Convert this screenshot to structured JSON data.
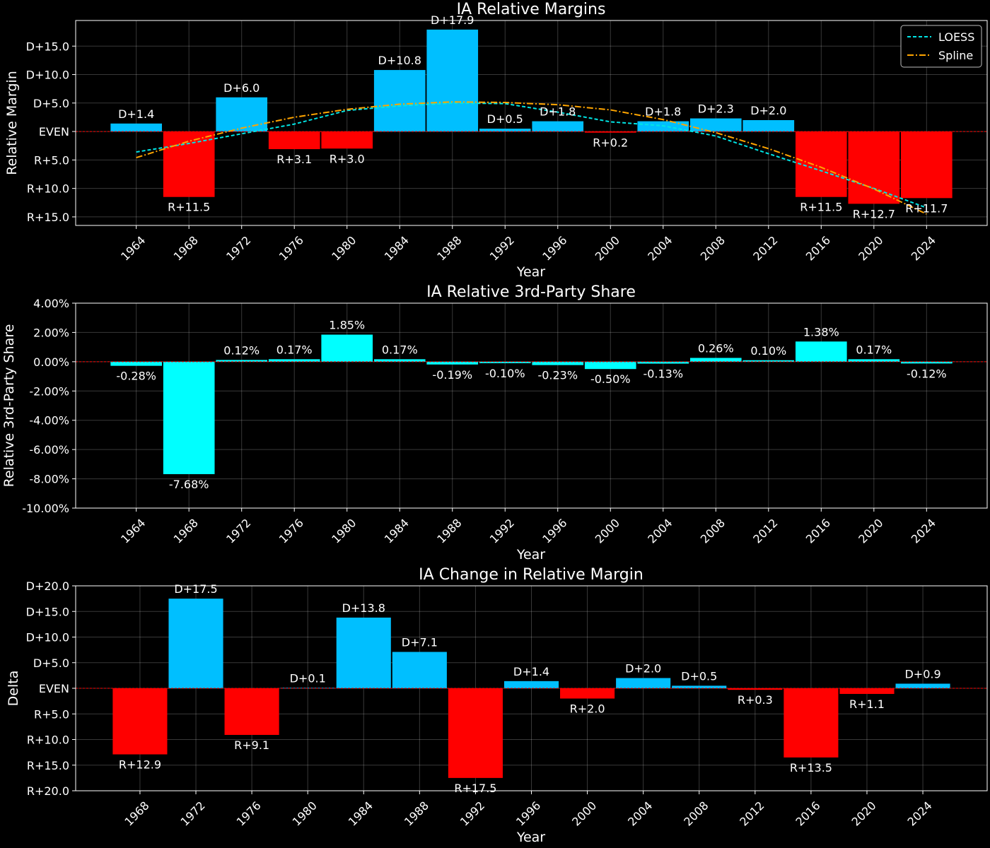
{
  "colors": {
    "background": "#000000",
    "dem": "#00bfff",
    "rep": "#ff0000",
    "third": "#00ffff",
    "zero_line": "#ff0000",
    "loess": "#00e5e5",
    "spline": "#ffa500"
  },
  "chart_data": [
    {
      "type": "bar",
      "title": "IA Relative Margins",
      "xlabel": "Year",
      "ylabel": "Relative Margin",
      "x": [
        1964,
        1968,
        1972,
        1976,
        1980,
        1984,
        1988,
        1992,
        1996,
        2000,
        2004,
        2008,
        2012,
        2016,
        2020,
        2024
      ],
      "x_tick_labels": [
        "1964",
        "1968",
        "1972",
        "1976",
        "1980",
        "1984",
        "1988",
        "1992",
        "1996",
        "2000",
        "2004",
        "2008",
        "2012",
        "2016",
        "2020",
        "2024"
      ],
      "values": [
        1.4,
        -11.5,
        6.0,
        -3.1,
        -3.0,
        10.8,
        17.9,
        0.5,
        1.8,
        -0.2,
        1.8,
        2.3,
        2.0,
        -11.5,
        -12.7,
        -11.7
      ],
      "labels": [
        "D+1.4",
        "R+11.5",
        "D+6.0",
        "R+3.1",
        "R+3.0",
        "D+10.8",
        "D+17.9",
        "D+0.5",
        "D+1.8",
        "R+0.2",
        "D+1.8",
        "D+2.3",
        "D+2.0",
        "R+11.5",
        "R+12.7",
        "R+11.7"
      ],
      "ylim": [
        -16.5,
        19.5
      ],
      "y_ticks": [
        15,
        10,
        5,
        0,
        -5,
        -10,
        -15
      ],
      "y_tick_labels": [
        "D+15.0",
        "D+10.0",
        "D+5.0",
        "EVEN",
        "R+5.0",
        "R+10.0",
        "R+15.0"
      ],
      "grid": true,
      "legend": {
        "placement": "top-right",
        "entries": [
          "LOESS",
          "Spline"
        ]
      },
      "lines": [
        {
          "name": "LOESS",
          "style": "dashed",
          "x": [
            1964,
            1968,
            1972,
            1976,
            1980,
            1984,
            1988,
            1992,
            1996,
            2000,
            2004,
            2008,
            2012,
            2016,
            2020,
            2024
          ],
          "values": [
            -3.6,
            -2.1,
            -0.4,
            1.3,
            3.7,
            4.5,
            5.0,
            4.9,
            3.4,
            1.7,
            1.0,
            -0.8,
            -3.9,
            -6.9,
            -10.0,
            -13.4
          ]
        },
        {
          "name": "Spline",
          "style": "dashdot",
          "x": [
            1964,
            1968,
            1972,
            1976,
            1980,
            1984,
            1988,
            1992,
            1996,
            2000,
            2004,
            2008,
            2012,
            2016,
            2020,
            2024
          ],
          "values": [
            -4.6,
            -1.7,
            0.6,
            2.5,
            3.9,
            4.8,
            5.2,
            5.1,
            4.7,
            3.8,
            2.1,
            -0.2,
            -3.0,
            -6.3,
            -10.1,
            -14.5
          ]
        }
      ]
    },
    {
      "type": "bar",
      "title": "IA Relative 3rd-Party Share",
      "xlabel": "Year",
      "ylabel": "Relative 3rd-Party Share",
      "x": [
        1964,
        1968,
        1972,
        1976,
        1980,
        1984,
        1988,
        1992,
        1996,
        2000,
        2004,
        2008,
        2012,
        2016,
        2020,
        2024
      ],
      "x_tick_labels": [
        "1964",
        "1968",
        "1972",
        "1976",
        "1980",
        "1984",
        "1988",
        "1992",
        "1996",
        "2000",
        "2004",
        "2008",
        "2012",
        "2016",
        "2020",
        "2024"
      ],
      "values": [
        -0.28,
        -7.68,
        0.12,
        0.17,
        1.85,
        0.17,
        -0.19,
        -0.1,
        -0.23,
        -0.5,
        -0.13,
        0.26,
        0.1,
        1.38,
        0.17,
        -0.12
      ],
      "labels": [
        "-0.28%",
        "-7.68%",
        "0.12%",
        "0.17%",
        "1.85%",
        "0.17%",
        "-0.19%",
        "-0.10%",
        "-0.23%",
        "-0.50%",
        "-0.13%",
        "0.26%",
        "0.10%",
        "1.38%",
        "0.17%",
        "-0.12%"
      ],
      "ylim": [
        -10,
        4
      ],
      "y_ticks": [
        4,
        2,
        0,
        -2,
        -4,
        -6,
        -8,
        -10
      ],
      "y_tick_labels": [
        "4.00%",
        "2.00%",
        "0.00%",
        "-2.00%",
        "-4.00%",
        "-6.00%",
        "-8.00%",
        "-10.00%"
      ],
      "grid": true
    },
    {
      "type": "bar",
      "title": "IA Change in Relative Margin",
      "xlabel": "Year",
      "ylabel": "Delta",
      "x": [
        1968,
        1972,
        1976,
        1980,
        1984,
        1988,
        1992,
        1996,
        2000,
        2004,
        2008,
        2012,
        2016,
        2020,
        2024
      ],
      "x_tick_labels": [
        "1968",
        "1972",
        "1976",
        "1980",
        "1984",
        "1988",
        "1992",
        "1996",
        "2000",
        "2004",
        "2008",
        "2012",
        "2016",
        "2020",
        "2024"
      ],
      "values": [
        -12.9,
        17.5,
        -9.1,
        0.1,
        13.8,
        7.1,
        -17.5,
        1.4,
        -2.0,
        2.0,
        0.5,
        -0.3,
        -13.5,
        -1.1,
        0.9
      ],
      "labels": [
        "R+12.9",
        "D+17.5",
        "R+9.1",
        "D+0.1",
        "D+13.8",
        "D+7.1",
        "R+17.5",
        "D+1.4",
        "R+2.0",
        "D+2.0",
        "D+0.5",
        "R+0.3",
        "R+13.5",
        "R+1.1",
        "D+0.9"
      ],
      "ylim": [
        -20,
        20
      ],
      "y_ticks": [
        20,
        15,
        10,
        5,
        0,
        -5,
        -10,
        -15,
        -20
      ],
      "y_tick_labels": [
        "D+20.0",
        "D+15.0",
        "D+10.0",
        "D+5.0",
        "EVEN",
        "R+5.0",
        "R+10.0",
        "R+15.0",
        "R+20.0"
      ],
      "grid": true
    }
  ]
}
